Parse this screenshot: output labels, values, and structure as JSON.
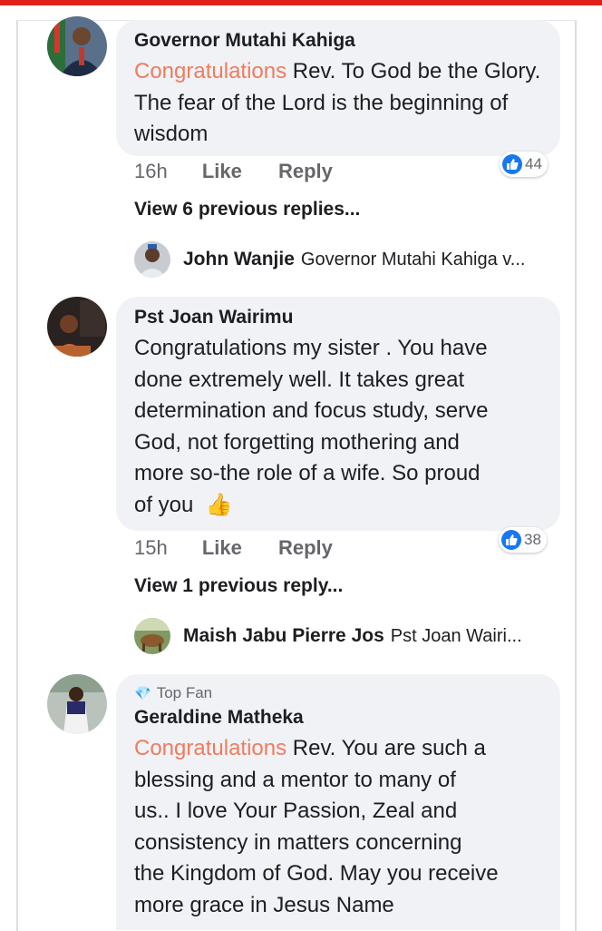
{
  "comments": [
    {
      "author": "Governor Mutahi Kahiga",
      "highlight": "Congratulations",
      "text": " Rev. To God be the Glory. The fear of the Lord is the beginning of wisdom",
      "time": "16h",
      "like_label": "Like",
      "reply_label": "Reply",
      "reactions": "44",
      "view_previous": "View 6 previous replies...",
      "latest_reply": {
        "name": "John Wanjie",
        "text": "Governor Mutahi Kahiga v..."
      }
    },
    {
      "author": "Pst Joan Wairimu",
      "text_lines": [
        "Congratulations my sister . You have",
        "done extremely well. It takes great",
        "determination and focus study, serve",
        "God, not forgetting mothering  and",
        "more so-the role of a wife. So proud",
        "of you"
      ],
      "emoji": "👍",
      "time": "15h",
      "like_label": "Like",
      "reply_label": "Reply",
      "reactions": "38",
      "view_previous": "View 1 previous reply...",
      "latest_reply": {
        "name": "Maish Jabu Pierre Jos",
        "text": "Pst Joan Wairi..."
      }
    },
    {
      "badge": "Top Fan",
      "author": "Geraldine Matheka",
      "highlight": "Congratulations",
      "text_lines": [
        " Rev. You are such a",
        "blessing and a mentor to many of",
        "us.. I love Your Passion, Zeal and",
        "consistency in matters concerning",
        "the Kingdom of God. May you receive",
        "more grace in Jesus Name"
      ]
    }
  ],
  "colors": {
    "accent": "#1877f2",
    "highlight": "#f07b5f",
    "bubble": "#f0f2f5",
    "top_bar": "#e0201c"
  }
}
